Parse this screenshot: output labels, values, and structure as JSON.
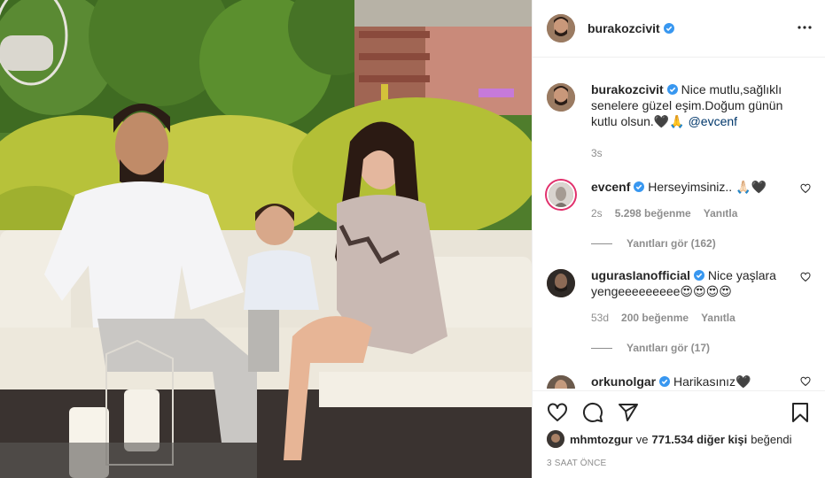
{
  "post": {
    "author": "burakozcivit",
    "photo_alt": "Family photo on a garden sofa"
  },
  "caption": {
    "username": "burakozcivit",
    "text": "Nice mutlu,sağlıklı senelere güzel eşim.Doğum günün kutlu olsun.🖤🙏 ",
    "mention": "@evcenf",
    "time": "3s"
  },
  "comments": [
    {
      "username": "evcenf",
      "text": "Herseyimsiniz.. 🙏🏻🖤",
      "time": "2s",
      "likes": "5.298 beğenme",
      "reply": "Yanıtla",
      "view_replies": "Yanıtları gör (162)"
    },
    {
      "username": "ugurasIanofficial",
      "text": "Nice yaşlara yengeeeeeeeee😍😍😍😍",
      "time": "53d",
      "likes": "200 beğenme",
      "reply": "Yanıtla",
      "view_replies": "Yanıtları gör (17)"
    },
    {
      "username": "orkunolgar",
      "text": "Harikasınız🖤"
    }
  ],
  "liked_by": {
    "user": "mhmtozgur",
    "connector": "ve",
    "others": "771.534 diğer kişi",
    "suffix": "beğendi"
  },
  "timestamp": "3 SAAT ÖNCE",
  "colors": {
    "verified": "#3897f0",
    "text": "#262626",
    "muted": "#8e8e8e",
    "link": "#00376b",
    "story_ring": "#e1306c"
  },
  "icons": [
    "more-icon",
    "verified-icon",
    "heart-icon",
    "comment-icon",
    "share-icon",
    "bookmark-icon"
  ]
}
